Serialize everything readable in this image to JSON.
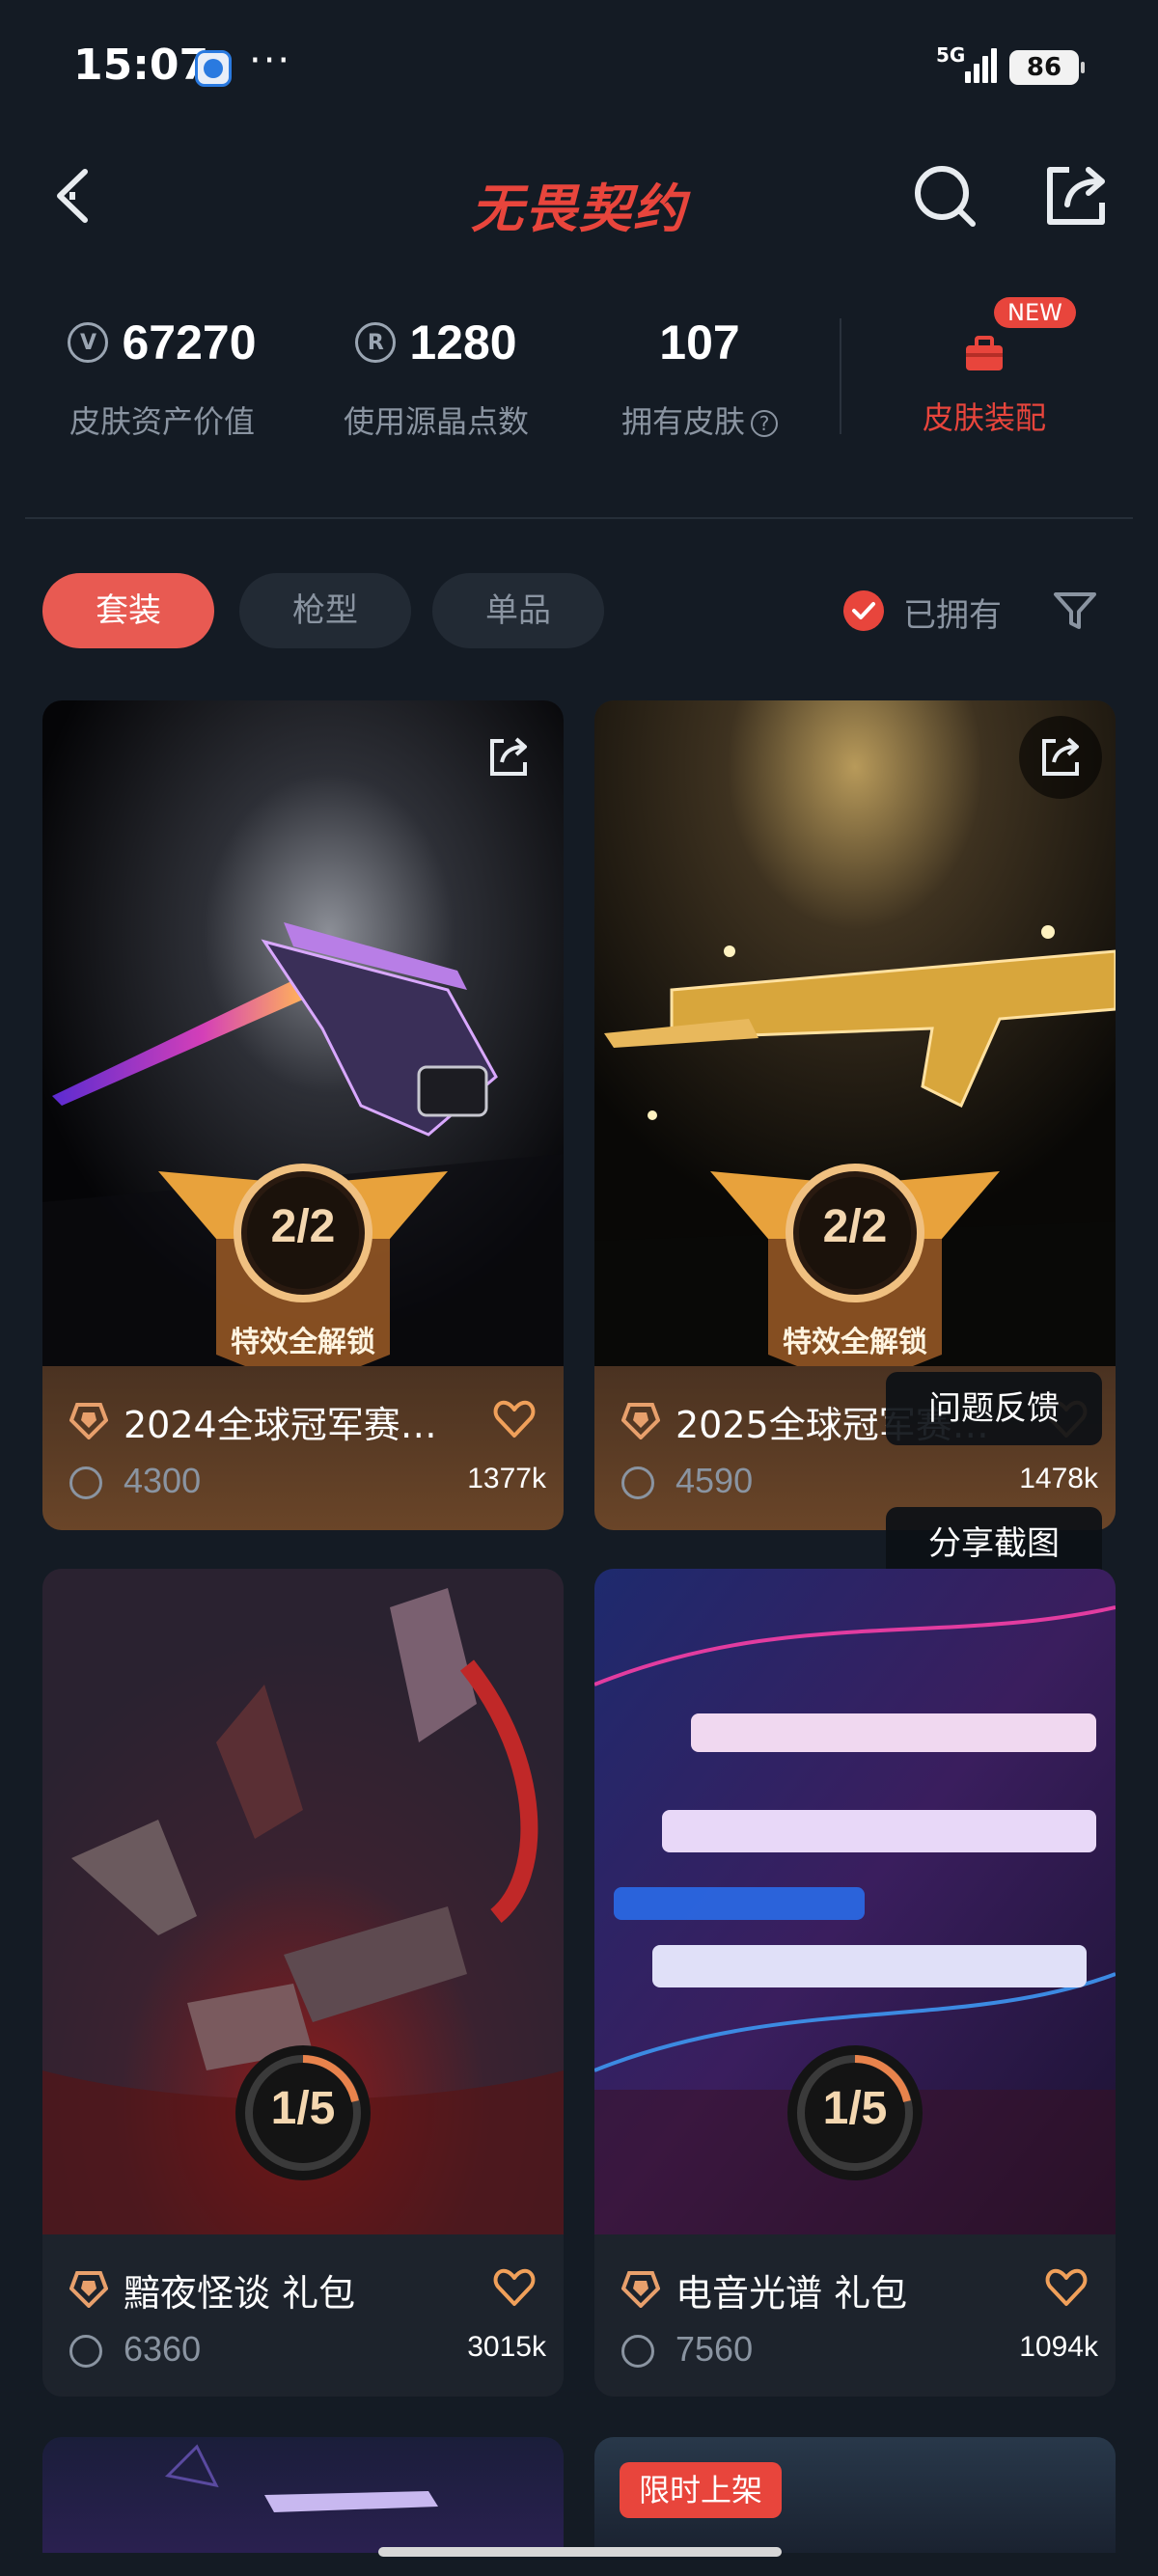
{
  "status_bar": {
    "time": "15:07",
    "dots": "···",
    "network": "5G",
    "battery": "86"
  },
  "header": {
    "title": "无畏契约",
    "back_icon": "chevron-left-icon",
    "search_icon": "search-icon",
    "share_icon": "share-icon"
  },
  "stats": {
    "asset_value": "67270",
    "asset_label": "皮肤资产价值",
    "points_value": "1280",
    "points_label": "使用源晶点数",
    "skins_value": "107",
    "skins_label": "拥有皮肤",
    "outfit_label": "皮肤装配",
    "new_badge": "NEW"
  },
  "filters": {
    "tabs": [
      "套装",
      "枪型",
      "单品"
    ],
    "active_tab": "套装",
    "owned_label": "已拥有"
  },
  "cards": [
    {
      "title": "2024全球冠军赛…",
      "price": "4300",
      "likes": "1377k",
      "progress": "2/2",
      "caption": "特效全解锁"
    },
    {
      "title": "2025全球冠军赛…",
      "price": "4590",
      "likes": "1478k",
      "progress": "2/2",
      "caption": "特效全解锁"
    },
    {
      "title": "黯夜怪谈 礼包",
      "price": "6360",
      "likes": "3015k",
      "progress": "1/5"
    },
    {
      "title": "电音光谱 礼包",
      "price": "7560",
      "likes": "1094k",
      "progress": "1/5"
    }
  ],
  "floating": {
    "feedback": "问题反馈",
    "screenshot_share": "分享截图"
  },
  "limited_tag": "限时上架",
  "colors": {
    "accent": "#e8453c",
    "background": "#141b24",
    "card_gold": "#6a4528"
  }
}
